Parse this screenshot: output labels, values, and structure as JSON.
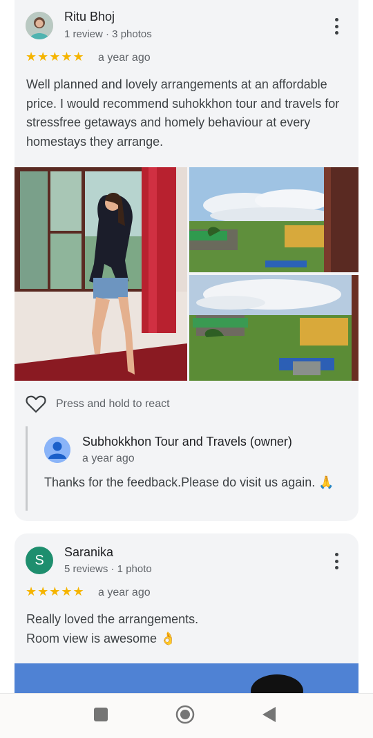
{
  "reviews": [
    {
      "name": "Ritu Bhoj",
      "meta": "1 review · 3 photos",
      "rating": 5,
      "stars": "★★★★★",
      "time": "a year ago",
      "text": "Well planned and lovely arrangements at an affordable price. I would recommend suhokkhon tour and travels for stressfree getaways and homely behaviour at every homestays they arrange.",
      "react_label": "Press and hold to react",
      "owner_reply": {
        "name": "Subhokkhon Tour and Travels (owner)",
        "time": "a year ago",
        "text": "Thanks for the feedback.Please do visit us again. 🙏"
      }
    },
    {
      "name": "Saranika",
      "avatar_letter": "S",
      "meta": "5 reviews · 1 photo",
      "rating": 5,
      "stars": "★★★★★",
      "time": "a year ago",
      "text_line1": "Really loved the arrangements.",
      "text_line2": "Room view is awesome 👌"
    }
  ],
  "colors": {
    "star": "#f5b400",
    "avatar2": "#1e8e6e",
    "card_bg": "#f3f4f6",
    "owner_avatar": "#8ab4f8"
  },
  "nav": {
    "icons": [
      "recent-apps-icon",
      "home-icon",
      "back-icon"
    ]
  }
}
